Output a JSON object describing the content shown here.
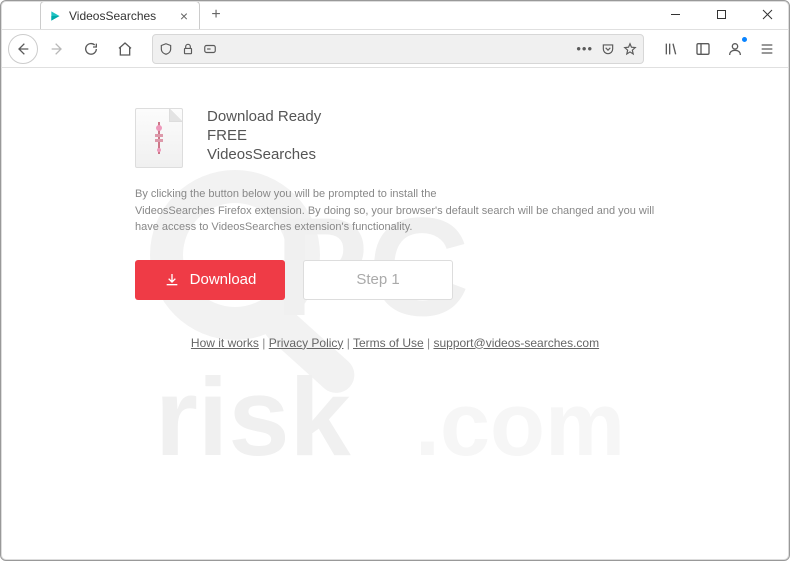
{
  "window": {
    "tab_title": "VideosSearches"
  },
  "page": {
    "heading": {
      "line1": "Download Ready",
      "line2": "FREE",
      "line3": "VideosSearches"
    },
    "disclaimer": "By clicking the button below you will be prompted to install the\nVideosSearches Firefox extension. By doing so, your browser's default search will be changed and you will have access to VideosSearches extension's functionality.",
    "buttons": {
      "download": "Download",
      "step1": "Step 1"
    },
    "footer": {
      "how_it_works": "How it works",
      "privacy_policy": "Privacy Policy",
      "terms_of_use": "Terms of Use",
      "support_email": "support@videos-searches.com",
      "sep": " | "
    }
  }
}
